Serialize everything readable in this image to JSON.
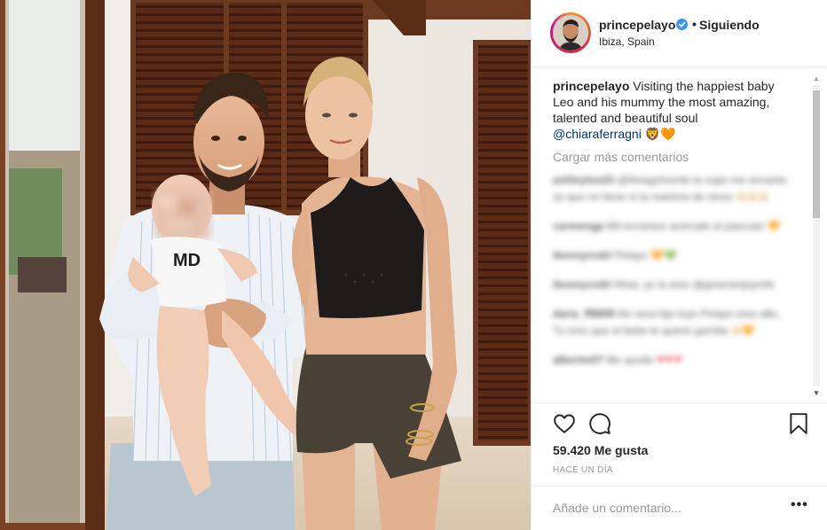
{
  "post": {
    "username": "princepelayo",
    "follow_status": "Siguiendo",
    "separator": "•",
    "location": "Ibiza, Spain",
    "caption_user": "princepelayo",
    "caption_text": "Visiting the happiest baby Leo and his mummy the most amazing, talented and beautiful soul",
    "caption_mention": "@chiaraferragni",
    "caption_emoji": "🦁🧡",
    "load_more": "Cargar más comentarios",
    "likes": "59.420 Me gusta",
    "time": "HACE UN DÍA",
    "add_comment_placeholder": "Añade un comentario...",
    "more_options": "•••"
  },
  "blurred_comments": [
    {
      "user": "ashleyton23",
      "text": "@theagnhomte la cope me encanta se que no tiene ni la mamma de ninos",
      "emoji": "😀😀😀"
    },
    {
      "user": "carmengp",
      "text": "Mil encantos acercate al pascuas",
      "emoji": "🧡"
    },
    {
      "user": "ibonnyrodri",
      "text": "Pelayo",
      "emoji": "🧡💚"
    },
    {
      "user": "ibonnyrodri",
      "text": "Wow, yo la amo @greenenjoyrofe",
      "emoji": ""
    },
    {
      "user": "daria_ff8899",
      "text": "No sera hijo tuyo Pelayo eres alto, Tu eres que el bebe te quiere garrida",
      "emoji": "😀🧡"
    },
    {
      "user": "albertm07",
      "text": "Me ayuda",
      "emoji": "❤❤❤"
    }
  ],
  "colors": {
    "text": "#262626",
    "muted": "#999999",
    "link": "#003569",
    "verified": "#3897f0",
    "border": "#efefef"
  },
  "icons": {
    "like": "heart-icon",
    "comment": "comment-icon",
    "save": "bookmark-icon",
    "verified": "verified-badge-icon",
    "options": "more-options-icon"
  }
}
